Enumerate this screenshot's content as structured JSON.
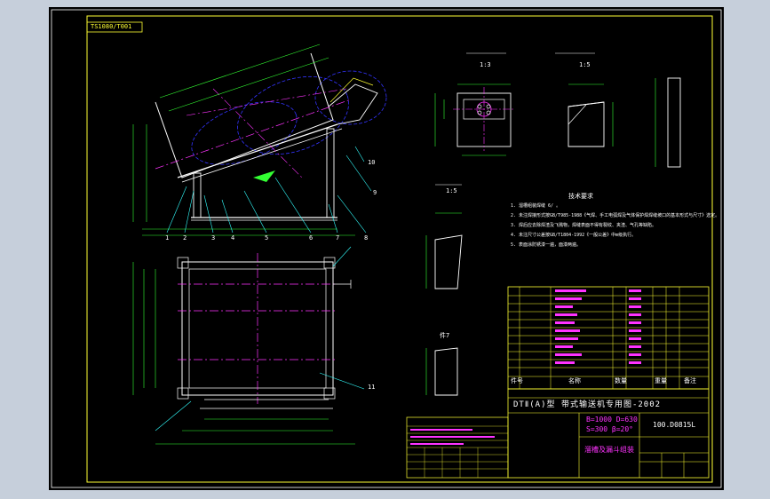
{
  "drawing": {
    "code_box": "TS1080/T001",
    "main_title": "DTⅡ(A)型  带式输送机专用图-2002",
    "spec_line1": "B=1000 D=630",
    "spec_line2": "S=300 β=20°",
    "drawing_no": "100.D0815L",
    "part_name": "溜槽及漏斗组装",
    "table_header_row": [
      "件号",
      "名称",
      "数量",
      "重量",
      "备注"
    ],
    "callouts": [
      "1",
      "2",
      "3",
      "4",
      "5",
      "6",
      "7",
      "8",
      "9",
      "10",
      "11"
    ],
    "tech_req_title": "技术要求",
    "tech_req": [
      "1. 溜槽组装焊缝 6/ 。",
      "2. 未注焊接形式按GB/T985-1988《气焊、手工电弧焊及气体保护焊焊缝坡口的基本形式与尺寸》选定。",
      "3. 焊后应去除焊渣及飞溅物，焊缝表面不得有裂纹、夹渣、气孔等缺陷。",
      "4. 未注尺寸公差按GB/T1804-1992《一般公差》中m级执行。",
      "5. 表面涂防锈漆一遍，面漆两遍。"
    ],
    "section_labels": [
      "1:3",
      "1:5",
      "1:5",
      "件7"
    ],
    "colors": {
      "border": "#ffff33",
      "outline": "#ffffff",
      "centerline": "#ff33ff",
      "dimension": "#33ff33",
      "hidden": "#3333ff",
      "leader": "#33ffff"
    }
  }
}
